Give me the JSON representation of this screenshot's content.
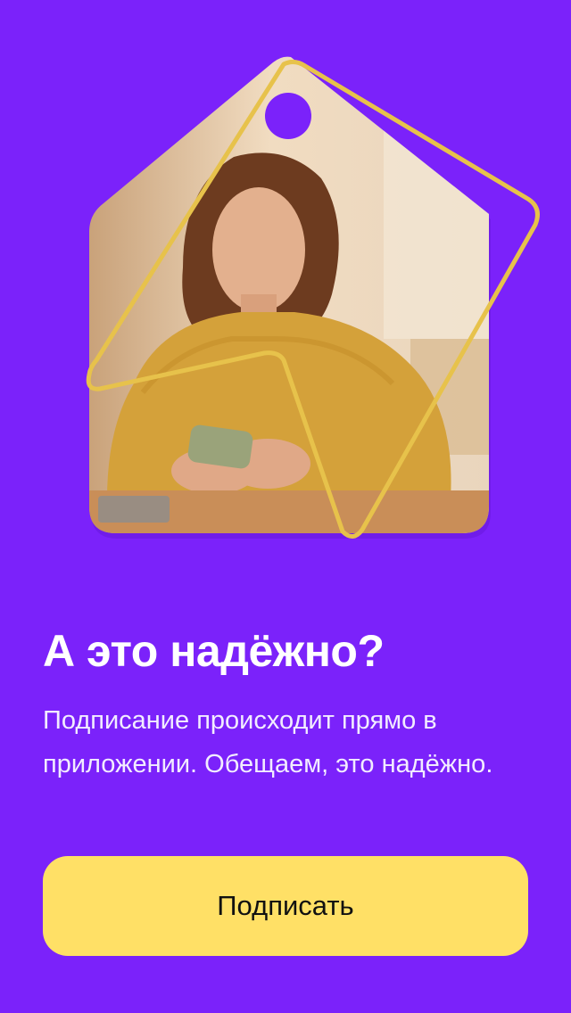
{
  "hero": {
    "illustration": "price-tag-photo-woman-with-phone",
    "accent_outline_color": "#e7c24b"
  },
  "content": {
    "title": "А это надёжно?",
    "description": "Подписание происходит прямо в приложении. Обещаем, это надёжно."
  },
  "actions": {
    "sign_label": "Подписать"
  },
  "colors": {
    "background": "#7b22fa",
    "button": "#ffe066",
    "text": "#ffffff"
  }
}
